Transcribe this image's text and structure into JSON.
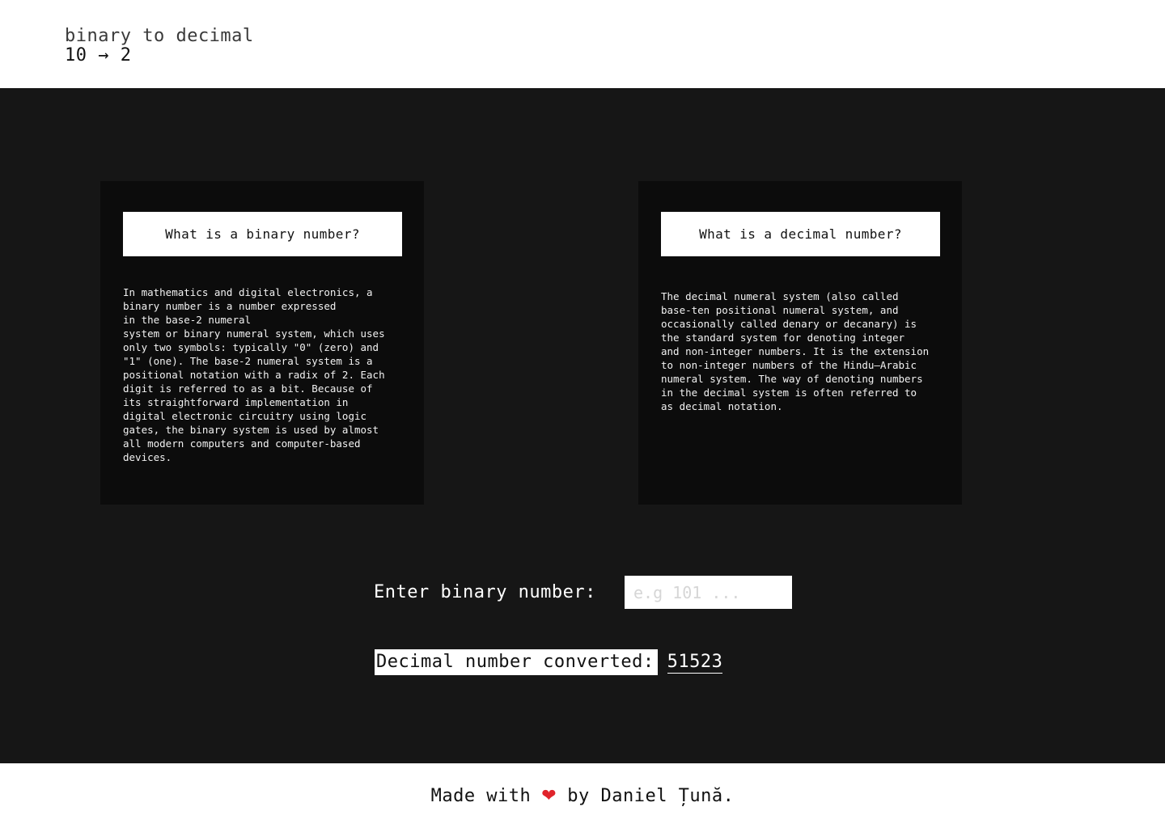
{
  "header": {
    "title": "binary to decimal",
    "subtitle": "10 → 2"
  },
  "cards": {
    "binary": {
      "title": "What is a binary number?",
      "body": "In mathematics and digital electronics, a\nbinary number is a number expressed\nin the base-2 numeral\nsystem or binary numeral system, which uses\nonly two symbols: typically \"0\" (zero) and\n\"1\" (one). The base-2 numeral system is a\npositional notation with a radix of 2. Each\ndigit is referred to as a bit. Because of\nits straightforward implementation in\ndigital electronic circuitry using logic\ngates, the binary system is used by almost\nall modern computers and computer-based\ndevices."
    },
    "decimal": {
      "title": "What is a decimal number?",
      "body": "The decimal numeral system (also called\nbase-ten positional numeral system, and\noccasionally called denary or decanary) is\nthe standard system for denoting integer\nand non-integer numbers. It is the extension\nto non-integer numbers of the Hindu–Arabic\nnumeral system. The way of denoting numbers\nin the decimal system is often referred to\nas decimal notation."
    }
  },
  "converter": {
    "input_label": "Enter binary number:",
    "input_placeholder": "e.g 101 ...",
    "input_value": "",
    "result_label": "Decimal number converted:",
    "result_value": "51523"
  },
  "footer": {
    "prefix": "Made with",
    "heart_icon": "heart-icon",
    "suffix": "by Daniel Țună."
  },
  "colors": {
    "background_dark": "#161616",
    "card_background": "#0c0c0c",
    "header_background": "#ffffff",
    "heart": "#e0242b"
  }
}
